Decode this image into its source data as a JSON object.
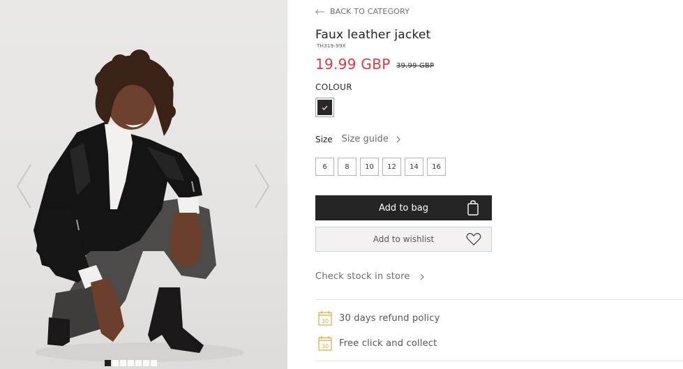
{
  "gallery": {
    "active_index": 0,
    "dot_count": 7,
    "prev_icon": "chevron-left-icon",
    "next_icon": "chevron-right-icon"
  },
  "product": {
    "back_label": "BACK TO CATEGORY",
    "title": "Faux leather jacket",
    "sku": "TH319-99X",
    "price": "19.99 GBP",
    "old_price": "39.99 GBP",
    "colour_label": "COLOUR",
    "size_label": "Size",
    "size_guide_label": "Size guide",
    "sizes": [
      "6",
      "8",
      "10",
      "12",
      "14",
      "16"
    ],
    "add_to_bag_label": "Add to bag",
    "add_to_wishlist_label": "Add to wishlist",
    "check_stock_label": "Check stock in store",
    "perks": [
      {
        "icon": "calendar-30-icon",
        "label": "30 days refund policy"
      },
      {
        "icon": "calendar-30-icon",
        "label": "Free click and collect"
      }
    ]
  },
  "colors": {
    "price_red": "#e0393e",
    "button_dark": "#252525",
    "perk_icon": "#e0a83a",
    "swatch_black": "#2a2725"
  }
}
